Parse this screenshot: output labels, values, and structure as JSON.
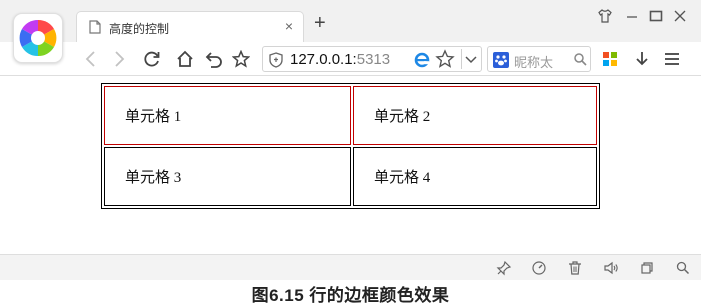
{
  "browser": {
    "tab": {
      "title": "高度的控制",
      "close_glyph": "×"
    },
    "new_tab_glyph": "+",
    "address": {
      "host": "127.0.0.1:",
      "port": "5313"
    },
    "search": {
      "placeholder": "昵称太",
      "engine_icon": "baidu-paw-icon"
    },
    "window_controls": [
      "shirt-icon",
      "minimize-icon",
      "maximize-icon",
      "close-icon"
    ]
  },
  "table": {
    "rows": [
      {
        "border_color": "#c00000",
        "cells": [
          "单元格 1",
          "单元格 2"
        ]
      },
      {
        "border_color": "#000000",
        "cells": [
          "单元格 3",
          "单元格 4"
        ]
      }
    ]
  },
  "caption": "图6.15  行的边框颜色效果"
}
